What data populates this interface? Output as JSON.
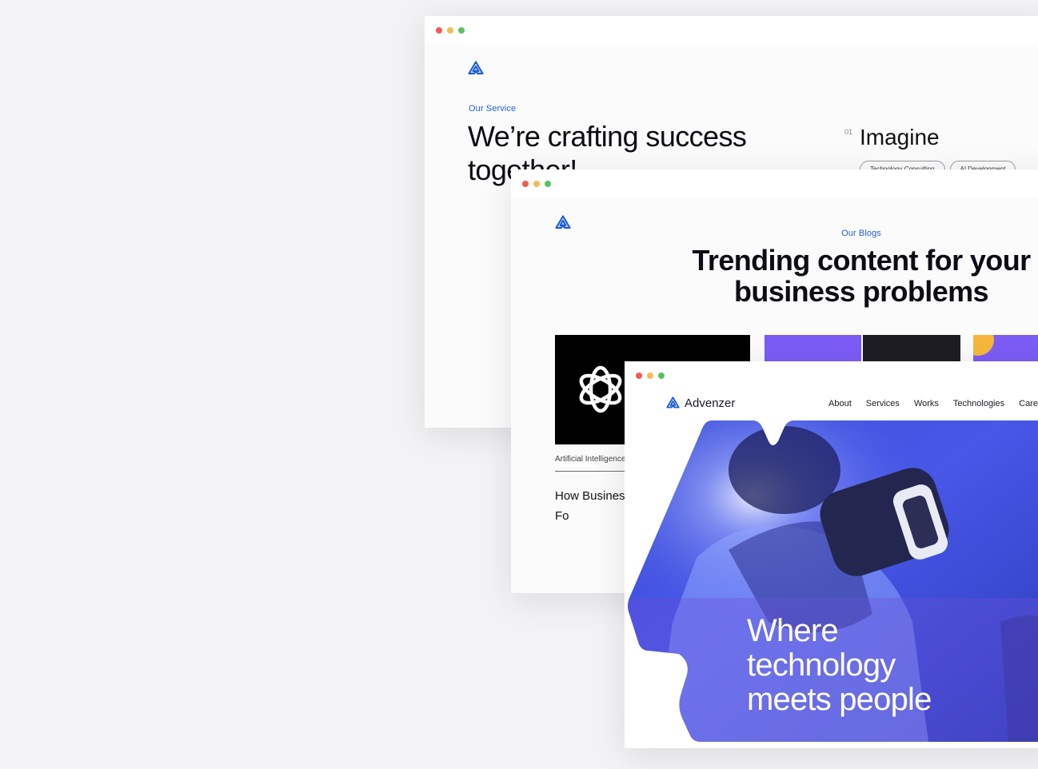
{
  "window_controls": {
    "close": "#f25b5b",
    "minimize": "#f5bd4f",
    "maximize": "#5cc160"
  },
  "accent_color": "#1f5fd6",
  "services_window": {
    "eyebrow": "Our Service",
    "title": "We’re crafting success together!",
    "service_number": "01",
    "service_name": "Imagine",
    "tags": [
      "Technology Consulting",
      "AI Development"
    ]
  },
  "blogs_window": {
    "eyebrow": "Our Blogs",
    "title_line1": "Trending content for your",
    "title_line2": "business problems",
    "cards": [
      {
        "category": "Artificial Intelligence",
        "headline": "How Businesses Use AI Models to Fo",
        "image_icon": "openai-icon"
      }
    ]
  },
  "home_window": {
    "brand": "Advenzer",
    "nav": [
      "About",
      "Services",
      "Works",
      "Technologies",
      "Careers"
    ],
    "hero_line1": "Where",
    "hero_line2": "technology",
    "hero_line3": "meets people"
  }
}
